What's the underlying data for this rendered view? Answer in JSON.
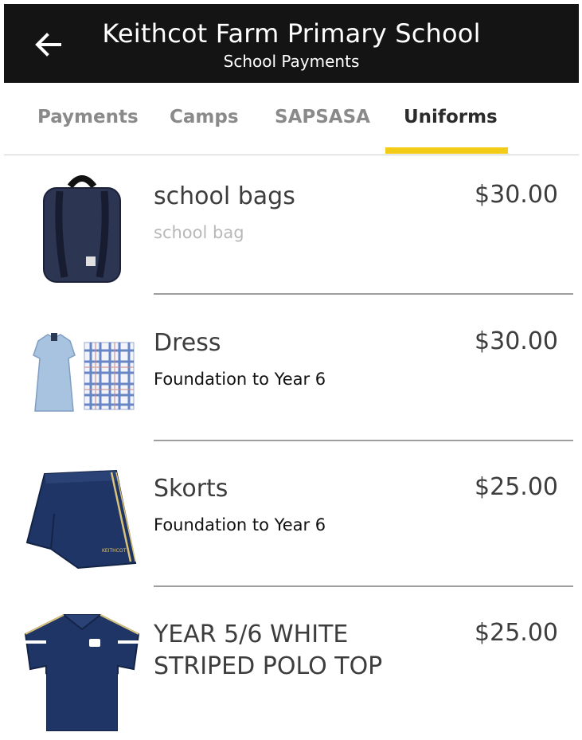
{
  "header": {
    "title": "Keithcot Farm Primary School",
    "subtitle": "School Payments"
  },
  "tabs": [
    {
      "label": "Payments",
      "active": false
    },
    {
      "label": "Camps",
      "active": false
    },
    {
      "label": "SAPSASA",
      "active": false
    },
    {
      "label": "Uniforms",
      "active": true
    }
  ],
  "colors": {
    "header_bg": "#141414",
    "tab_indicator": "#f2cc16",
    "uniform_navy": "#1f3566",
    "dress_blue": "#a8c3e0"
  },
  "items": [
    {
      "name": "school bags",
      "description": "school bag",
      "price": "$30.00",
      "thumbnail": "backpack-icon"
    },
    {
      "name": "Dress",
      "description": "Foundation to Year 6",
      "price": "$30.00",
      "thumbnail": "dress-icon"
    },
    {
      "name": "Skorts",
      "description": "Foundation to Year 6",
      "price": "$25.00",
      "thumbnail": "skort-icon"
    },
    {
      "name": "YEAR 5/6  WHITE STRIPED POLO TOP",
      "description": "",
      "price": "$25.00",
      "thumbnail": "polo-shirt-icon"
    }
  ]
}
